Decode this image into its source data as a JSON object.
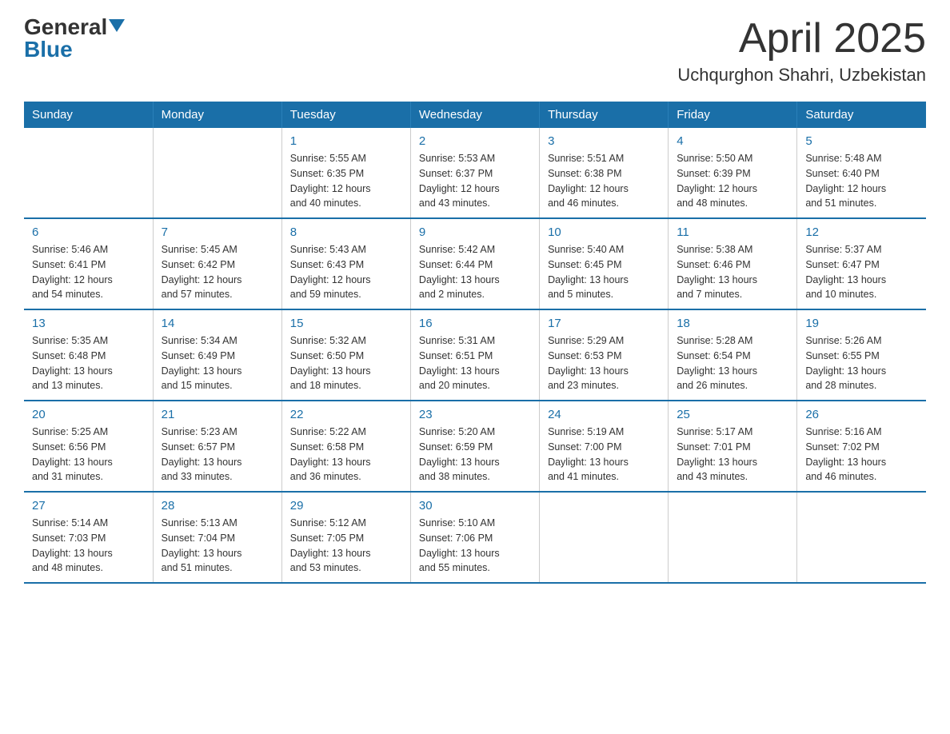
{
  "header": {
    "logo_general": "General",
    "logo_blue": "Blue",
    "title": "April 2025",
    "subtitle": "Uchqurghon Shahri, Uzbekistan"
  },
  "weekdays": [
    "Sunday",
    "Monday",
    "Tuesday",
    "Wednesday",
    "Thursday",
    "Friday",
    "Saturday"
  ],
  "weeks": [
    [
      {
        "day": "",
        "info": ""
      },
      {
        "day": "",
        "info": ""
      },
      {
        "day": "1",
        "info": "Sunrise: 5:55 AM\nSunset: 6:35 PM\nDaylight: 12 hours\nand 40 minutes."
      },
      {
        "day": "2",
        "info": "Sunrise: 5:53 AM\nSunset: 6:37 PM\nDaylight: 12 hours\nand 43 minutes."
      },
      {
        "day": "3",
        "info": "Sunrise: 5:51 AM\nSunset: 6:38 PM\nDaylight: 12 hours\nand 46 minutes."
      },
      {
        "day": "4",
        "info": "Sunrise: 5:50 AM\nSunset: 6:39 PM\nDaylight: 12 hours\nand 48 minutes."
      },
      {
        "day": "5",
        "info": "Sunrise: 5:48 AM\nSunset: 6:40 PM\nDaylight: 12 hours\nand 51 minutes."
      }
    ],
    [
      {
        "day": "6",
        "info": "Sunrise: 5:46 AM\nSunset: 6:41 PM\nDaylight: 12 hours\nand 54 minutes."
      },
      {
        "day": "7",
        "info": "Sunrise: 5:45 AM\nSunset: 6:42 PM\nDaylight: 12 hours\nand 57 minutes."
      },
      {
        "day": "8",
        "info": "Sunrise: 5:43 AM\nSunset: 6:43 PM\nDaylight: 12 hours\nand 59 minutes."
      },
      {
        "day": "9",
        "info": "Sunrise: 5:42 AM\nSunset: 6:44 PM\nDaylight: 13 hours\nand 2 minutes."
      },
      {
        "day": "10",
        "info": "Sunrise: 5:40 AM\nSunset: 6:45 PM\nDaylight: 13 hours\nand 5 minutes."
      },
      {
        "day": "11",
        "info": "Sunrise: 5:38 AM\nSunset: 6:46 PM\nDaylight: 13 hours\nand 7 minutes."
      },
      {
        "day": "12",
        "info": "Sunrise: 5:37 AM\nSunset: 6:47 PM\nDaylight: 13 hours\nand 10 minutes."
      }
    ],
    [
      {
        "day": "13",
        "info": "Sunrise: 5:35 AM\nSunset: 6:48 PM\nDaylight: 13 hours\nand 13 minutes."
      },
      {
        "day": "14",
        "info": "Sunrise: 5:34 AM\nSunset: 6:49 PM\nDaylight: 13 hours\nand 15 minutes."
      },
      {
        "day": "15",
        "info": "Sunrise: 5:32 AM\nSunset: 6:50 PM\nDaylight: 13 hours\nand 18 minutes."
      },
      {
        "day": "16",
        "info": "Sunrise: 5:31 AM\nSunset: 6:51 PM\nDaylight: 13 hours\nand 20 minutes."
      },
      {
        "day": "17",
        "info": "Sunrise: 5:29 AM\nSunset: 6:53 PM\nDaylight: 13 hours\nand 23 minutes."
      },
      {
        "day": "18",
        "info": "Sunrise: 5:28 AM\nSunset: 6:54 PM\nDaylight: 13 hours\nand 26 minutes."
      },
      {
        "day": "19",
        "info": "Sunrise: 5:26 AM\nSunset: 6:55 PM\nDaylight: 13 hours\nand 28 minutes."
      }
    ],
    [
      {
        "day": "20",
        "info": "Sunrise: 5:25 AM\nSunset: 6:56 PM\nDaylight: 13 hours\nand 31 minutes."
      },
      {
        "day": "21",
        "info": "Sunrise: 5:23 AM\nSunset: 6:57 PM\nDaylight: 13 hours\nand 33 minutes."
      },
      {
        "day": "22",
        "info": "Sunrise: 5:22 AM\nSunset: 6:58 PM\nDaylight: 13 hours\nand 36 minutes."
      },
      {
        "day": "23",
        "info": "Sunrise: 5:20 AM\nSunset: 6:59 PM\nDaylight: 13 hours\nand 38 minutes."
      },
      {
        "day": "24",
        "info": "Sunrise: 5:19 AM\nSunset: 7:00 PM\nDaylight: 13 hours\nand 41 minutes."
      },
      {
        "day": "25",
        "info": "Sunrise: 5:17 AM\nSunset: 7:01 PM\nDaylight: 13 hours\nand 43 minutes."
      },
      {
        "day": "26",
        "info": "Sunrise: 5:16 AM\nSunset: 7:02 PM\nDaylight: 13 hours\nand 46 minutes."
      }
    ],
    [
      {
        "day": "27",
        "info": "Sunrise: 5:14 AM\nSunset: 7:03 PM\nDaylight: 13 hours\nand 48 minutes."
      },
      {
        "day": "28",
        "info": "Sunrise: 5:13 AM\nSunset: 7:04 PM\nDaylight: 13 hours\nand 51 minutes."
      },
      {
        "day": "29",
        "info": "Sunrise: 5:12 AM\nSunset: 7:05 PM\nDaylight: 13 hours\nand 53 minutes."
      },
      {
        "day": "30",
        "info": "Sunrise: 5:10 AM\nSunset: 7:06 PM\nDaylight: 13 hours\nand 55 minutes."
      },
      {
        "day": "",
        "info": ""
      },
      {
        "day": "",
        "info": ""
      },
      {
        "day": "",
        "info": ""
      }
    ]
  ]
}
